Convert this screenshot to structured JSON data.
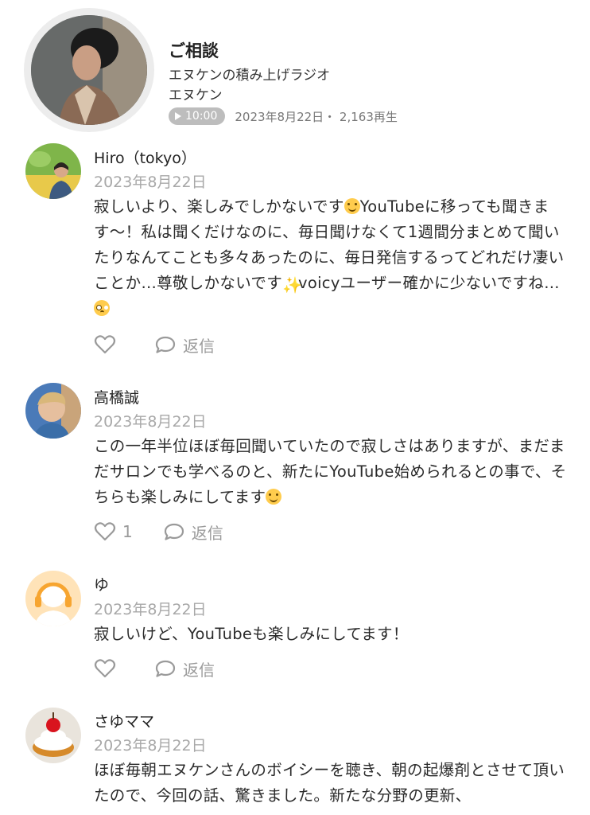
{
  "episode": {
    "title": "ご相談",
    "show": "エヌケンの積み上げラジオ",
    "author": "エヌケン",
    "duration": "10:00",
    "date_plays": "2023年8月22日・ 2,163再生",
    "icon": "play-icon"
  },
  "reply_label": "返信",
  "comments": [
    {
      "name": "Hiro（tokyo）",
      "date": "2023年8月22日",
      "text_1": "寂しいより、楽しみでしかないです",
      "text_2": "YouTubeに移っても聞きます〜！私は聞くだけなのに、毎日聞けなくて1週間分まとめて聞いたりなんてことも多々あったのに、毎日発信するってどれだけ凄いことか…尊敬しかないです",
      "text_3": "voicyユーザー確かに少ないですね…",
      "likes": ""
    },
    {
      "name": "高橋誠",
      "date": "2023年8月22日",
      "text_1": "この一年半位ほぼ毎回聞いていたので寂しさはありますが、まだまだサロンでも学べるのと、新たにYouTube始められるとの事で、そちらも楽しみにしてます",
      "likes": "1"
    },
    {
      "name": "ゆ",
      "date": "2023年8月22日",
      "text_1": "寂しいけど、YouTubeも楽しみにしてます！",
      "likes": ""
    },
    {
      "name": "さゆママ",
      "date": "2023年8月22日",
      "text_1": "ほぼ毎朝エヌケンさんのボイシーを聴き、朝の起爆剤とさせて頂いたので、今回の話、驚きました。新たな分野の更新、"
    }
  ]
}
